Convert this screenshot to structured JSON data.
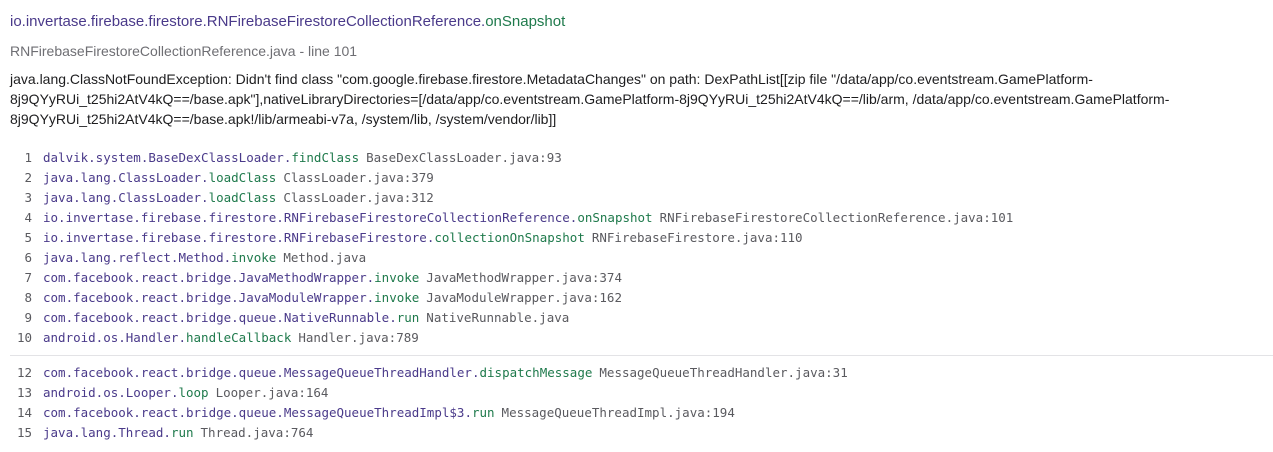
{
  "header": {
    "title_class": "io.invertase.firebase.firestore.RNFirebaseFirestoreCollectionReference",
    "title_dot": ".",
    "title_method": "onSnapshot",
    "subtitle": "RNFirebaseFirestoreCollectionReference.java - line 101",
    "message": "java.lang.ClassNotFoundException: Didn't find class \"com.google.firebase.firestore.MetadataChanges\" on path: DexPathList[[zip file \"/data/app/co.eventstream.GamePlatform-8j9QYyRUi_t25hi2AtV4kQ==/base.apk\"],nativeLibraryDirectories=[/data/app/co.eventstream.GamePlatform-8j9QYyRUi_t25hi2AtV4kQ==/lib/arm, /data/app/co.eventstream.GamePlatform-8j9QYyRUi_t25hi2AtV4kQ==/base.apk!/lib/armeabi-v7a, /system/lib, /system/vendor/lib]]"
  },
  "colors": {
    "class": "#4a3a8a",
    "method": "#1f7a4c",
    "muted": "#6e6e73",
    "divider": "#e3e3e6"
  },
  "frames_top": [
    {
      "num": "1",
      "cls": "dalvik.system.BaseDexClassLoader",
      "method": "findClass",
      "file": "BaseDexClassLoader.java:93"
    },
    {
      "num": "2",
      "cls": "java.lang.ClassLoader",
      "method": "loadClass",
      "file": "ClassLoader.java:379"
    },
    {
      "num": "3",
      "cls": "java.lang.ClassLoader",
      "method": "loadClass",
      "file": "ClassLoader.java:312"
    },
    {
      "num": "4",
      "cls": "io.invertase.firebase.firestore.RNFirebaseFirestoreCollectionReference",
      "method": "onSnapshot",
      "file": "RNFirebaseFirestoreCollectionReference.java:101"
    },
    {
      "num": "5",
      "cls": "io.invertase.firebase.firestore.RNFirebaseFirestore",
      "method": "collectionOnSnapshot",
      "file": "RNFirebaseFirestore.java:110"
    },
    {
      "num": "6",
      "cls": "java.lang.reflect.Method",
      "method": "invoke",
      "file": "Method.java"
    },
    {
      "num": "7",
      "cls": "com.facebook.react.bridge.JavaMethodWrapper",
      "method": "invoke",
      "file": "JavaMethodWrapper.java:374"
    },
    {
      "num": "8",
      "cls": "com.facebook.react.bridge.JavaModuleWrapper",
      "method": "invoke",
      "file": "JavaModuleWrapper.java:162"
    },
    {
      "num": "9",
      "cls": "com.facebook.react.bridge.queue.NativeRunnable",
      "method": "run",
      "file": "NativeRunnable.java"
    },
    {
      "num": "10",
      "cls": "android.os.Handler",
      "method": "handleCallback",
      "file": "Handler.java:789"
    }
  ],
  "frames_bottom": [
    {
      "num": "12",
      "cls": "com.facebook.react.bridge.queue.MessageQueueThreadHandler",
      "method": "dispatchMessage",
      "file": "MessageQueueThreadHandler.java:31"
    },
    {
      "num": "13",
      "cls": "android.os.Looper",
      "method": "loop",
      "file": "Looper.java:164"
    },
    {
      "num": "14",
      "cls": "com.facebook.react.bridge.queue.MessageQueueThreadImpl$3",
      "method": "run",
      "file": "MessageQueueThreadImpl.java:194"
    },
    {
      "num": "15",
      "cls": "java.lang.Thread",
      "method": "run",
      "file": "Thread.java:764"
    }
  ]
}
